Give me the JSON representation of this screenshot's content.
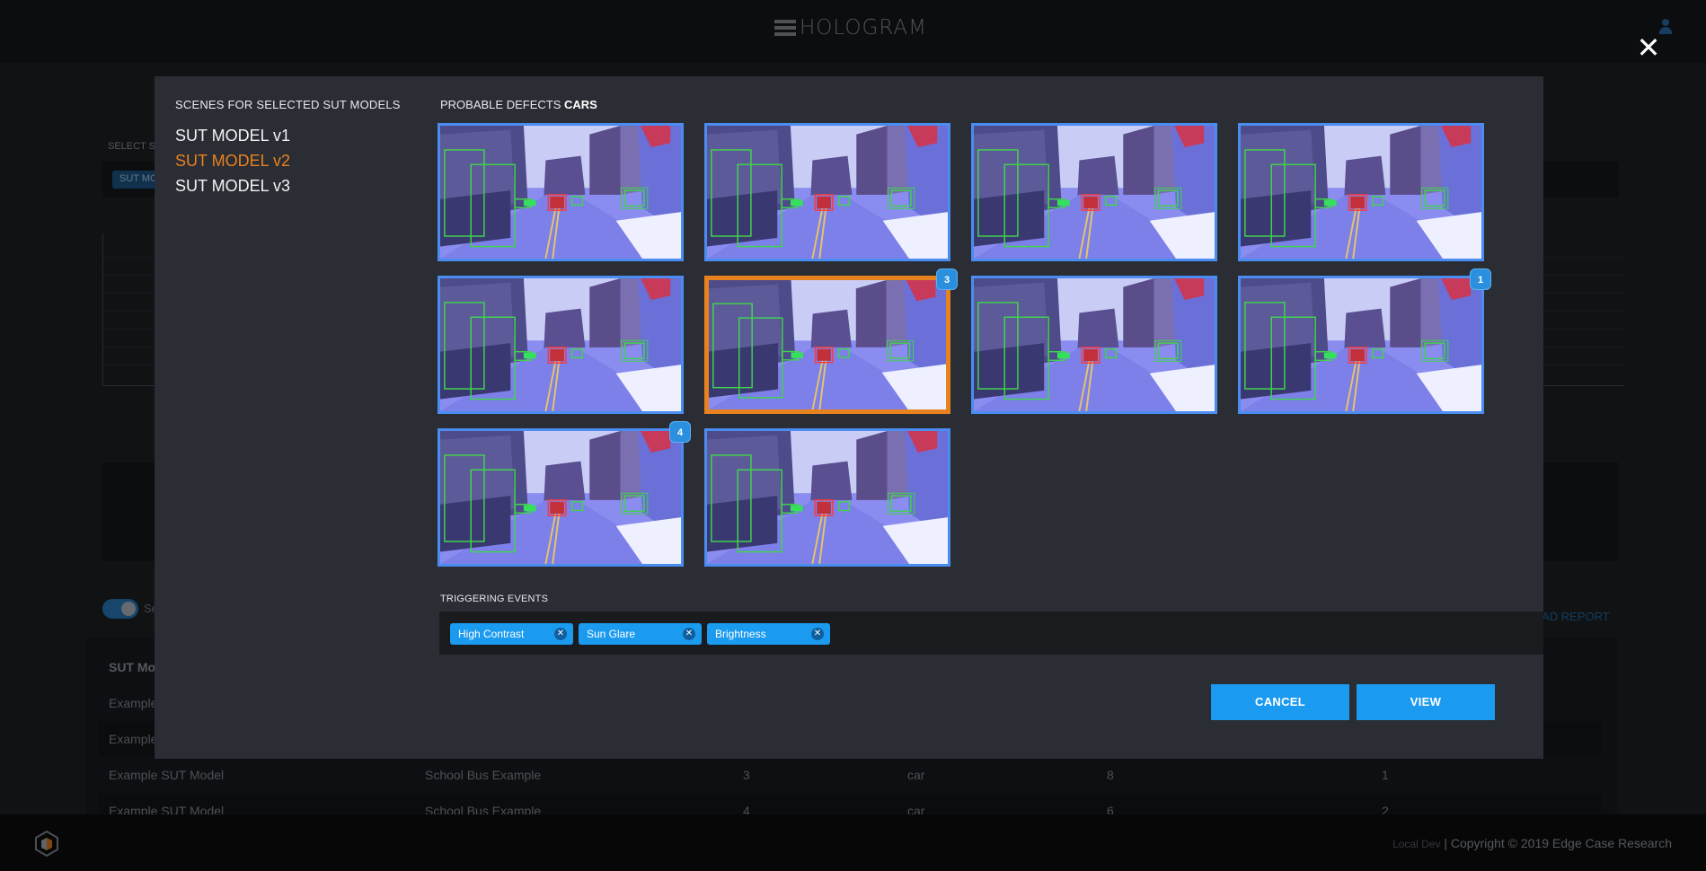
{
  "header": {
    "brand": "HOLOGRAM"
  },
  "background": {
    "select_label": "SELECT S",
    "chip": "SUT MO",
    "toggle_label": "Se",
    "download_label": "OAD REPORT",
    "table_header": "SUT Mo",
    "rows": [
      {
        "cells": [
          "Example",
          "",
          "",
          "",
          "",
          ""
        ]
      },
      {
        "cells": [
          "Example",
          "",
          "",
          "",
          "",
          ""
        ]
      },
      {
        "cells": [
          "Example SUT Model",
          "School Bus Example",
          "3",
          "car",
          "8",
          "1"
        ]
      },
      {
        "cells": [
          "Example SUT Model",
          "School Bus Example",
          "4",
          "car",
          "6",
          "2"
        ]
      }
    ]
  },
  "modal": {
    "scenes_title": "SCENES FOR SELECTED SUT MODELS",
    "models": [
      {
        "label": "SUT MODEL v1",
        "active": false
      },
      {
        "label": "SUT MODEL v2",
        "active": true
      },
      {
        "label": "SUT MODEL v3",
        "active": false
      }
    ],
    "defects_title": "PROBABLE DEFECTS",
    "defects_category": "CARS",
    "thumbnails": [
      {
        "selected": false,
        "badge": ""
      },
      {
        "selected": false,
        "badge": ""
      },
      {
        "selected": false,
        "badge": ""
      },
      {
        "selected": false,
        "badge": ""
      },
      {
        "selected": false,
        "badge": ""
      },
      {
        "selected": true,
        "badge": "3"
      },
      {
        "selected": false,
        "badge": ""
      },
      {
        "selected": false,
        "badge": "1"
      },
      {
        "selected": false,
        "badge": "4"
      },
      {
        "selected": false,
        "badge": ""
      }
    ],
    "events_title": "TRIGGERING EVENTS",
    "events": [
      "High Contrast",
      "Sun Glare",
      "Brightness"
    ],
    "cancel_label": "CANCEL",
    "view_label": "VIEW"
  },
  "footer": {
    "env": "Local Dev",
    "copyright": "| Copyright © 2019 Edge Case Research"
  },
  "colors": {
    "accent": "#1b9bf0",
    "selected": "#e8821e",
    "thumb_border": "#4a8cf0"
  }
}
